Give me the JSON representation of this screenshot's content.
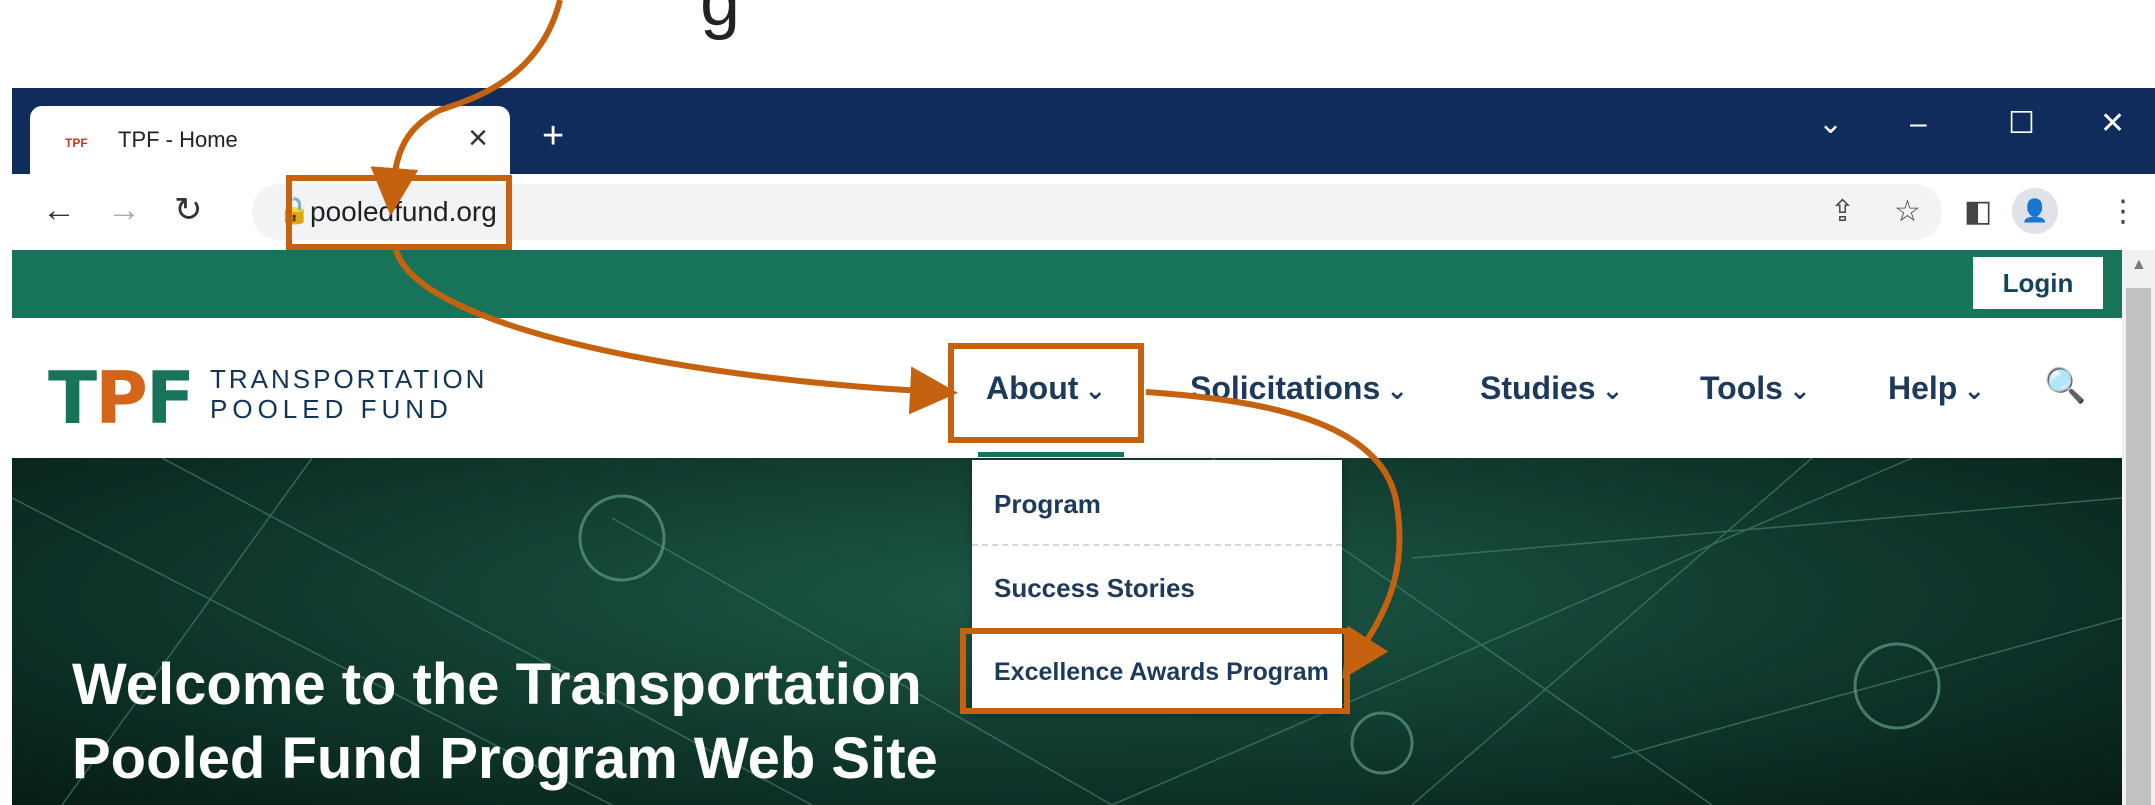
{
  "browser": {
    "tab": {
      "favicon": "TPF",
      "title": "TPF - Home",
      "close": "×"
    },
    "new_tab": "+",
    "window_controls": {
      "dropdown": "⌄",
      "minimize": "–",
      "maximize": "☐",
      "close": "✕"
    },
    "toolbar": {
      "back": "←",
      "forward": "→",
      "reload": "↻",
      "lock": "🔒",
      "url": "pooledfund.org",
      "share": "⇪",
      "star": "☆",
      "sidepanel": "◧",
      "profile": "👤",
      "menu": "⋮"
    }
  },
  "site": {
    "login_label": "Login",
    "logo": {
      "mark_t": "T",
      "mark_p": "P",
      "mark_f": "F",
      "line1": "TRANSPORTATION",
      "line2": "POOLED FUND"
    },
    "nav": [
      {
        "label": "About"
      },
      {
        "label": "Solicitations"
      },
      {
        "label": "Studies"
      },
      {
        "label": "Tools"
      },
      {
        "label": "Help"
      }
    ],
    "chevron": "⌄",
    "search_icon": "🔍",
    "about_dropdown": [
      "Program",
      "Success Stories",
      "Excellence Awards Program"
    ],
    "hero_title_line1": "Welcome to the Transportation",
    "hero_title_line2": "Pooled Fund Program Web Site"
  },
  "annotation": {
    "color": "#c4620f"
  }
}
